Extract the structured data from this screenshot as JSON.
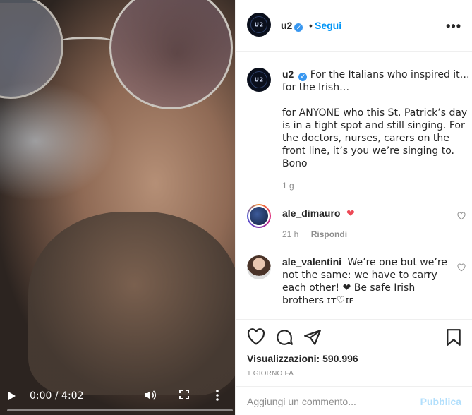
{
  "video": {
    "time": "0:00 / 4:02",
    "progress": 0,
    "icons": [
      "play-icon",
      "volume-icon",
      "fullscreen-icon",
      "more-vertical-icon"
    ]
  },
  "header": {
    "username": "u2",
    "separator": "•",
    "follow_label": "Segui",
    "more_label": "•••"
  },
  "caption": {
    "username": "u2",
    "text": "For the Italians who inspired it… for the Irish…\n\nfor ANYONE who this St. Patrick’s day is in a tight spot and still singing. For the doctors, nurses, carers on the front line, it’s you we’re singing to.\nBono",
    "time": "1 g"
  },
  "comments": [
    {
      "username": "ale_dimauro",
      "text": "❤",
      "time": "21 h",
      "reply_label": "Rispondi"
    },
    {
      "username": "ale_valentini",
      "text": "We’re one but we’re not the same: we have to carry each other! ❤ Be safe Irish brothers ɪᴛ♡ɪᴇ"
    }
  ],
  "actions": {
    "views_label": "Visualizzazioni:",
    "views_count": "590.996",
    "date": "1 GIORNO FA"
  },
  "add_comment": {
    "placeholder": "Aggiungi un commento...",
    "publish_label": "Pubblica"
  },
  "colors": {
    "link_blue": "#0095f6",
    "verified_blue": "#3897f0",
    "heart_red": "#ed4956",
    "publish_disabled": "#b2dffc",
    "muted_text": "#8e8e8e",
    "border": "#efefef"
  }
}
